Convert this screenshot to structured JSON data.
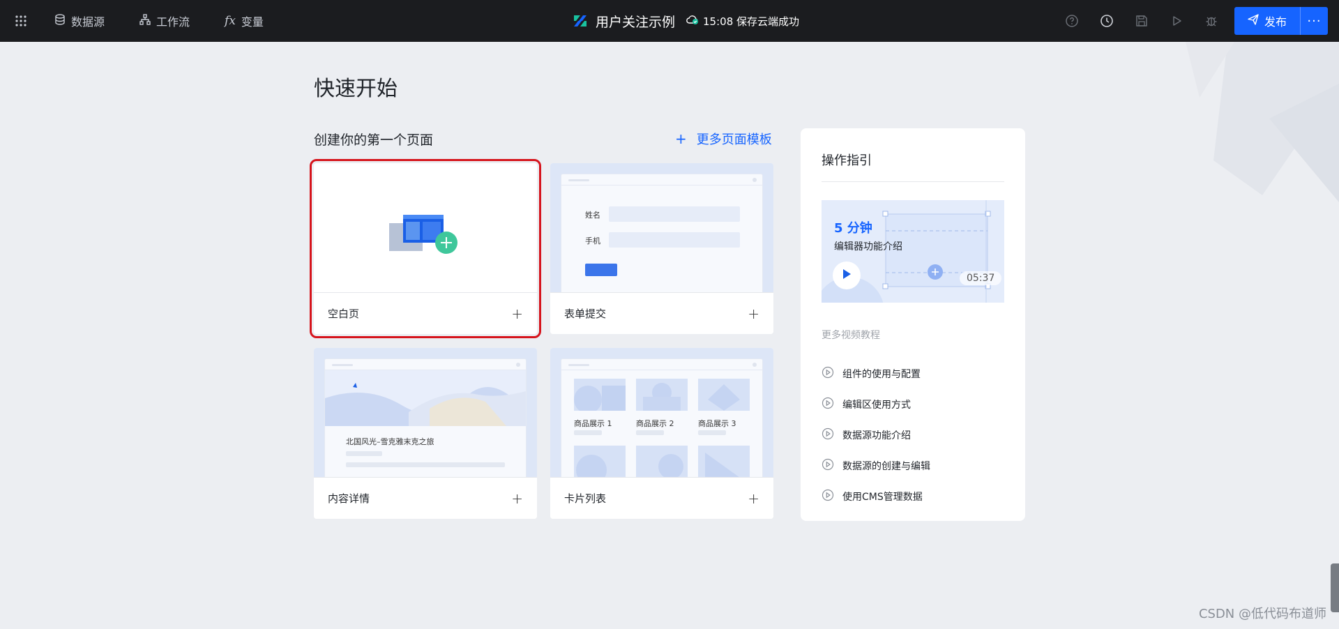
{
  "topbar": {
    "nav": [
      {
        "label": "数据源",
        "icon": "database-icon"
      },
      {
        "label": "工作流",
        "icon": "workflow-icon"
      },
      {
        "label": "变量",
        "icon": "function-icon"
      }
    ],
    "app_title": "用户关注示例",
    "save_status": "15:08 保存云端成功",
    "publish_label": "发布",
    "more_label": "···",
    "icons": [
      "help-icon",
      "history-icon",
      "save-icon",
      "preview-icon",
      "debug-icon"
    ]
  },
  "main": {
    "page_title": "快速开始",
    "section_title": "创建你的第一个页面",
    "more_templates": "更多页面模板",
    "cards": [
      {
        "label": "空白页",
        "selected": true
      },
      {
        "label": "表单提交"
      },
      {
        "label": "内容详情"
      },
      {
        "label": "卡片列表"
      }
    ],
    "form_preview": {
      "field1": "姓名",
      "field2": "手机"
    },
    "content_preview": {
      "headline": "北国风光–雪克雅末克之旅"
    },
    "card_preview": {
      "items": [
        "商品展示 1",
        "商品展示 2",
        "商品展示 3"
      ]
    }
  },
  "guide": {
    "title": "操作指引",
    "video_title": "5 分钟",
    "video_subtitle": "编辑器功能介绍",
    "video_duration": "05:37",
    "more_videos": "更多视频教程",
    "tutorials": [
      "组件的使用与配置",
      "编辑区使用方式",
      "数据源功能介绍",
      "数据源的创建与编辑",
      "使用CMS管理数据"
    ]
  },
  "watermark": "CSDN @低代码布道师",
  "colors": {
    "accent": "#1664ff",
    "topbar": "#1b1c1f",
    "selected_outline": "#d6141c"
  }
}
